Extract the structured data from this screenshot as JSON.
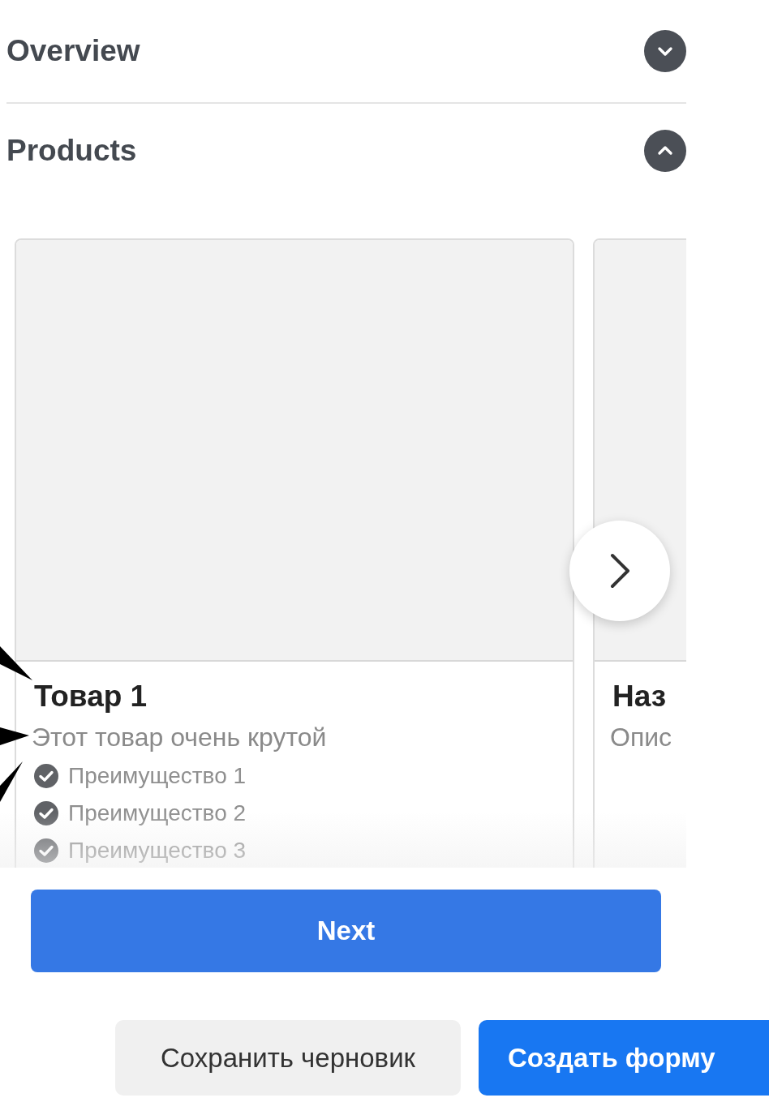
{
  "sections": [
    {
      "title": "Overview",
      "expanded": false
    },
    {
      "title": "Products",
      "expanded": true
    }
  ],
  "products": [
    {
      "title": "Товар 1",
      "description": "Этот товар очень крутой",
      "benefits": [
        "Преимущество 1",
        "Преимущество 2",
        "Преимущество 3"
      ]
    },
    {
      "title": "Наз",
      "description": "Опис"
    }
  ],
  "next_button": "Next",
  "actions": [
    {
      "label": "Сохранить черновик",
      "kind": "secondary"
    },
    {
      "label": "Создать форму",
      "kind": "primary"
    }
  ]
}
